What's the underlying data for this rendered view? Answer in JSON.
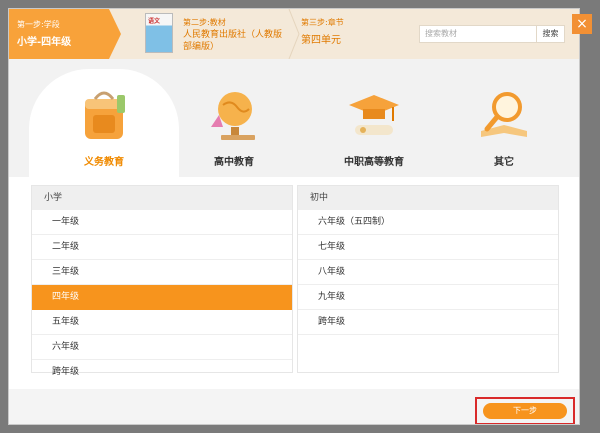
{
  "header": {
    "step1": {
      "label": "第一步:学段",
      "value": "小学-四年级"
    },
    "step2": {
      "label": "第二步:教材",
      "value": "人民教育出版社（人教版部编版）",
      "book_cover_text": "语文"
    },
    "step3": {
      "label": "第三步:章节",
      "value": "第四单元"
    },
    "search": {
      "placeholder": "搜索教材",
      "button": "搜索"
    },
    "close": "×"
  },
  "categories": [
    {
      "label": "义务教育",
      "icon": "backpack-icon",
      "active": true
    },
    {
      "label": "高中教育",
      "icon": "globe-icon",
      "active": false
    },
    {
      "label": "中职高等教育",
      "icon": "graduation-cap-icon",
      "active": false
    },
    {
      "label": "其它",
      "icon": "magnifier-book-icon",
      "active": false
    }
  ],
  "left_list": {
    "header": "小学",
    "items": [
      "一年级",
      "二年级",
      "三年级",
      "四年级",
      "五年级",
      "六年级",
      "跨年级"
    ],
    "selected": "四年级"
  },
  "right_list": {
    "header": "初中",
    "items": [
      "六年级（五四制）",
      "七年级",
      "八年级",
      "九年级",
      "跨年级"
    ]
  },
  "footer": {
    "next": "下一步"
  },
  "colors": {
    "accent": "#f7941d",
    "highlight_border": "#d92a2a"
  }
}
